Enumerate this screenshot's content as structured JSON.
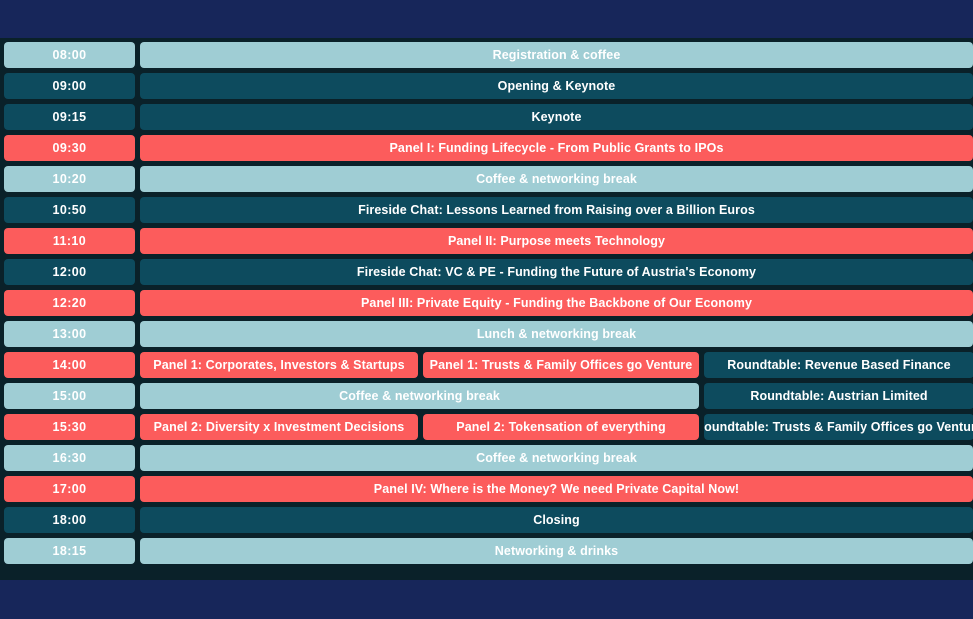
{
  "theme": {
    "page_background": "#17265a",
    "band_background": "#0a2129",
    "color_break": "#9fcdd4",
    "color_session": "#0d4b5e",
    "color_panel": "#fc5c5c",
    "text_color": "#ffffff"
  },
  "schedule": {
    "rows": [
      {
        "time": "08:00",
        "kind": "break",
        "layout": "full",
        "events": [
          {
            "title": "Registration & coffee",
            "kind": "break"
          }
        ]
      },
      {
        "time": "09:00",
        "kind": "session",
        "layout": "full",
        "events": [
          {
            "title": "Opening & Keynote",
            "kind": "session"
          }
        ]
      },
      {
        "time": "09:15",
        "kind": "session",
        "layout": "full",
        "events": [
          {
            "title": "Keynote",
            "kind": "session"
          }
        ]
      },
      {
        "time": "09:30",
        "kind": "panel",
        "layout": "full",
        "events": [
          {
            "title": "Panel I: Funding Lifecycle - From Public Grants to IPOs",
            "kind": "panel"
          }
        ]
      },
      {
        "time": "10:20",
        "kind": "break",
        "layout": "full",
        "events": [
          {
            "title": "Coffee & networking break",
            "kind": "break"
          }
        ]
      },
      {
        "time": "10:50",
        "kind": "session",
        "layout": "full",
        "events": [
          {
            "title": "Fireside Chat: Lessons Learned from Raising over a Billion Euros",
            "kind": "session"
          }
        ]
      },
      {
        "time": "11:10",
        "kind": "panel",
        "layout": "full",
        "events": [
          {
            "title": "Panel II: Purpose meets Technology",
            "kind": "panel"
          }
        ]
      },
      {
        "time": "12:00",
        "kind": "session",
        "layout": "full",
        "events": [
          {
            "title": "Fireside Chat: VC & PE - Funding the Future of Austria's Economy",
            "kind": "session"
          }
        ]
      },
      {
        "time": "12:20",
        "kind": "panel",
        "layout": "full",
        "events": [
          {
            "title": "Panel III: Private Equity - Funding the Backbone of Our Economy",
            "kind": "panel"
          }
        ]
      },
      {
        "time": "13:00",
        "kind": "break",
        "layout": "full",
        "events": [
          {
            "title": "Lunch & networking break",
            "kind": "break"
          }
        ]
      },
      {
        "time": "14:00",
        "kind": "panel",
        "layout": "split3",
        "events": [
          {
            "title": "Panel 1: Corporates, Investors & Startups",
            "kind": "panel",
            "col": "a"
          },
          {
            "title": "Panel 1: Trusts & Family Offices go Venture",
            "kind": "panel",
            "col": "b"
          },
          {
            "title": "Roundtable: Revenue Based Finance",
            "kind": "session",
            "col": "c"
          }
        ]
      },
      {
        "time": "15:00",
        "kind": "break",
        "layout": "split-merged",
        "events": [
          {
            "title": "Coffee & networking break",
            "kind": "break",
            "col": "ab"
          },
          {
            "title": "Roundtable: Austrian Limited",
            "kind": "session",
            "col": "c"
          }
        ]
      },
      {
        "time": "15:30",
        "kind": "panel",
        "layout": "split3",
        "events": [
          {
            "title": "Panel 2: Diversity x Investment Decisions",
            "kind": "panel",
            "col": "a"
          },
          {
            "title": "Panel 2: Tokensation of everything",
            "kind": "panel",
            "col": "b"
          },
          {
            "title": "Roundtable: Trusts & Family Offices go Venture",
            "kind": "session",
            "col": "c"
          }
        ]
      },
      {
        "time": "16:30",
        "kind": "break",
        "layout": "full",
        "events": [
          {
            "title": "Coffee & networking break",
            "kind": "break"
          }
        ]
      },
      {
        "time": "17:00",
        "kind": "panel",
        "layout": "full",
        "events": [
          {
            "title": "Panel IV: Where is the Money? We need Private Capital Now!",
            "kind": "panel"
          }
        ]
      },
      {
        "time": "18:00",
        "kind": "session",
        "layout": "full",
        "events": [
          {
            "title": "Closing",
            "kind": "session"
          }
        ]
      },
      {
        "time": "18:15",
        "kind": "break",
        "layout": "full",
        "events": [
          {
            "title": "Networking & drinks",
            "kind": "break"
          }
        ]
      }
    ]
  }
}
